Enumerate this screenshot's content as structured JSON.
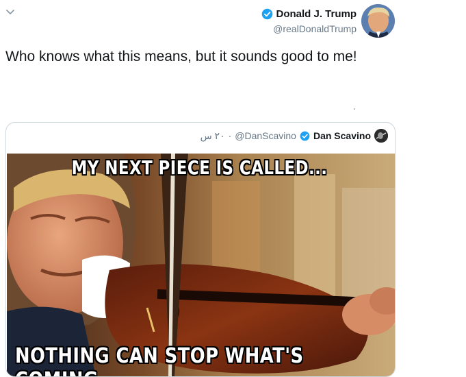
{
  "tweet": {
    "author_name": "Donald J. Trump",
    "author_handle": "@realDonaldTrump",
    "text": "Who knows what this means, but it sounds good to me!",
    "menu_icon": "chevron-down-icon",
    "verified_icon": "verified-badge-icon"
  },
  "quoted_tweet": {
    "author_name": "Dan Scavino",
    "author_handle": "@DanScavino",
    "timestamp": "٢٠ س",
    "separator": "·",
    "image": {
      "caption_top": "MY NEXT PIECE IS CALLED...",
      "caption_bottom": "NOTHING CAN STOP WHAT'S COMING."
    }
  },
  "colors": {
    "verified": "#1da1f2",
    "secondary_text": "#657786",
    "border": "#ccd6dd",
    "primary_text": "#14171a"
  }
}
